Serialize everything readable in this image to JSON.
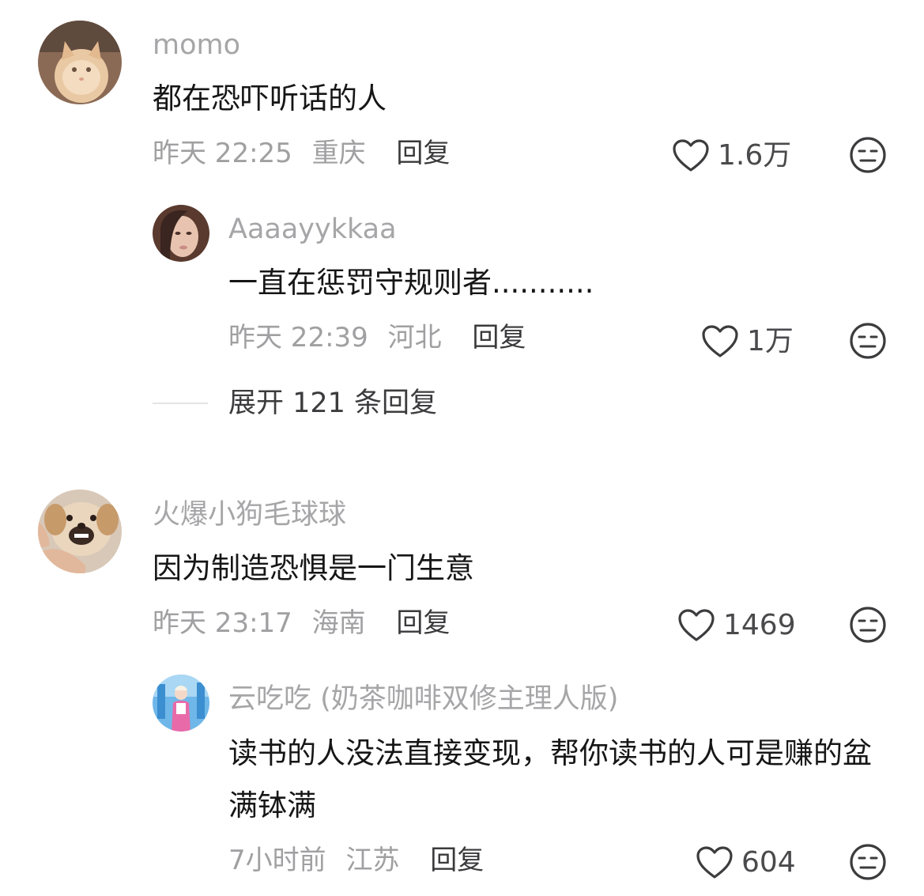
{
  "comments": [
    {
      "username": "momo",
      "text": "都在恐吓听话的人",
      "time": "昨天 22:25",
      "location": "重庆",
      "reply_label": "回复",
      "likes": "1.6万",
      "avatar_icon": "cat-avatar",
      "replies": [
        {
          "username": "Aaaayykkaa",
          "text": "一直在惩罚守规则者...........",
          "time": "昨天 22:39",
          "location": "河北",
          "reply_label": "回复",
          "likes": "1万",
          "avatar_icon": "woman-avatar"
        }
      ],
      "expand_label": "展开 121 条回复"
    },
    {
      "username": "火爆小狗毛球球",
      "text": "因为制造恐惧是一门生意",
      "time": "昨天 23:17",
      "location": "海南",
      "reply_label": "回复",
      "likes": "1469",
      "avatar_icon": "dog-avatar",
      "replies": [
        {
          "username": "云吃吃 (奶茶咖啡双修主理人版)",
          "text": "读书的人没法直接变现，帮你读书的人可是赚的盆满钵满",
          "time": "7小时前",
          "location": "江苏",
          "reply_label": "回复",
          "likes": "604",
          "avatar_icon": "blue-scene-avatar"
        }
      ]
    }
  ],
  "icons": {
    "like": "heart-outline-icon",
    "dislike": "neutral-face-icon"
  },
  "colors": {
    "username": "#a6a6a8",
    "meta": "#a0a0a2",
    "content": "#161616",
    "icon": "#4a4a4c"
  }
}
